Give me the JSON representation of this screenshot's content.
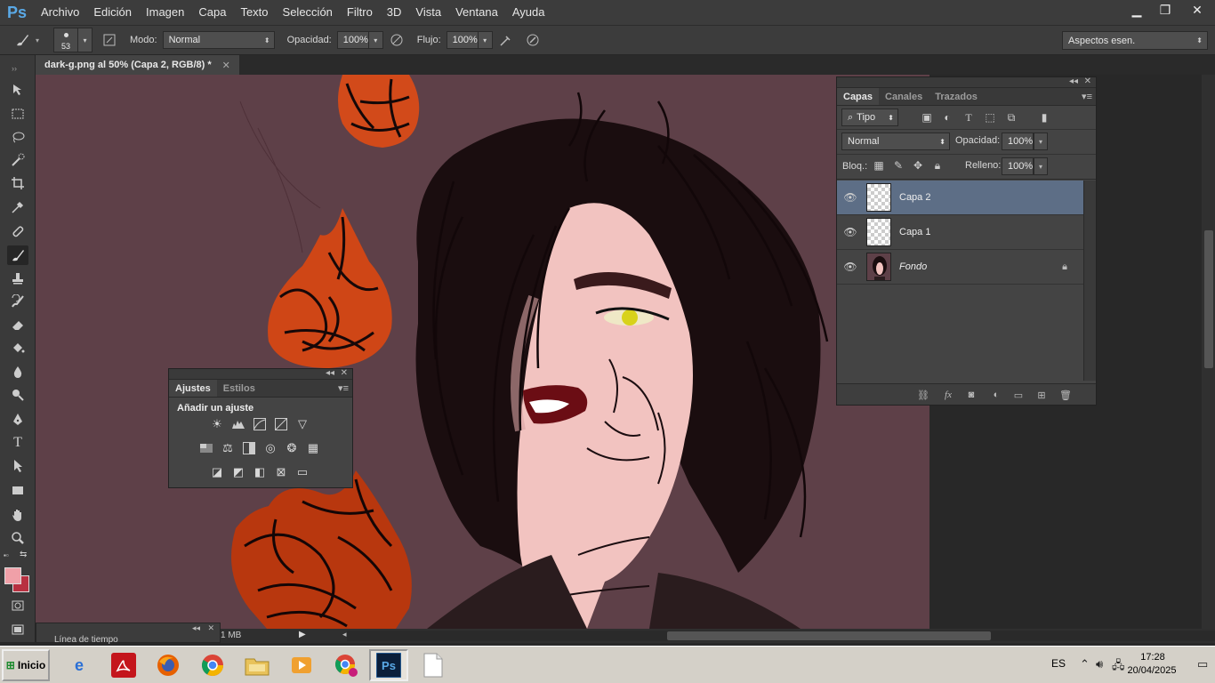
{
  "app": {
    "logo": "Ps"
  },
  "menu": [
    "Archivo",
    "Edición",
    "Imagen",
    "Capa",
    "Texto",
    "Selección",
    "Filtro",
    "3D",
    "Vista",
    "Ventana",
    "Ayuda"
  ],
  "options": {
    "brush_size": "53",
    "mode_label": "Modo:",
    "mode_value": "Normal",
    "opacity_label": "Opacidad:",
    "opacity_value": "100%",
    "flow_label": "Flujo:",
    "flow_value": "100%",
    "workspace": "Aspectos esen."
  },
  "document": {
    "tab_title": "dark-g.png al 50% (Capa 2, RGB/8) *",
    "status": "1 MB"
  },
  "timeline": {
    "title": "Línea de tiempo"
  },
  "adjustments_panel": {
    "tabs": [
      "Ajustes",
      "Estilos"
    ],
    "title": "Añadir un ajuste"
  },
  "layers_panel": {
    "tabs": [
      "Capas",
      "Canales",
      "Trazados"
    ],
    "filter_label": "Tipo",
    "blend_mode": "Normal",
    "opacity_label": "Opacidad:",
    "opacity_value": "100%",
    "lock_label": "Bloq.:",
    "fill_label": "Relleno:",
    "fill_value": "100%",
    "layers": [
      {
        "name": "Capa 2",
        "selected": true,
        "locked": false
      },
      {
        "name": "Capa 1",
        "selected": false,
        "locked": false
      },
      {
        "name": "Fondo",
        "selected": false,
        "locked": true
      }
    ]
  },
  "colors": {
    "foreground": "#f0a0a8",
    "background": "#b83040",
    "canvas_bg": "#5e4048",
    "selection": "#5d6e86"
  },
  "taskbar": {
    "start": "Inicio",
    "lang": "ES",
    "time": "17:28",
    "date": "20/04/2025"
  }
}
